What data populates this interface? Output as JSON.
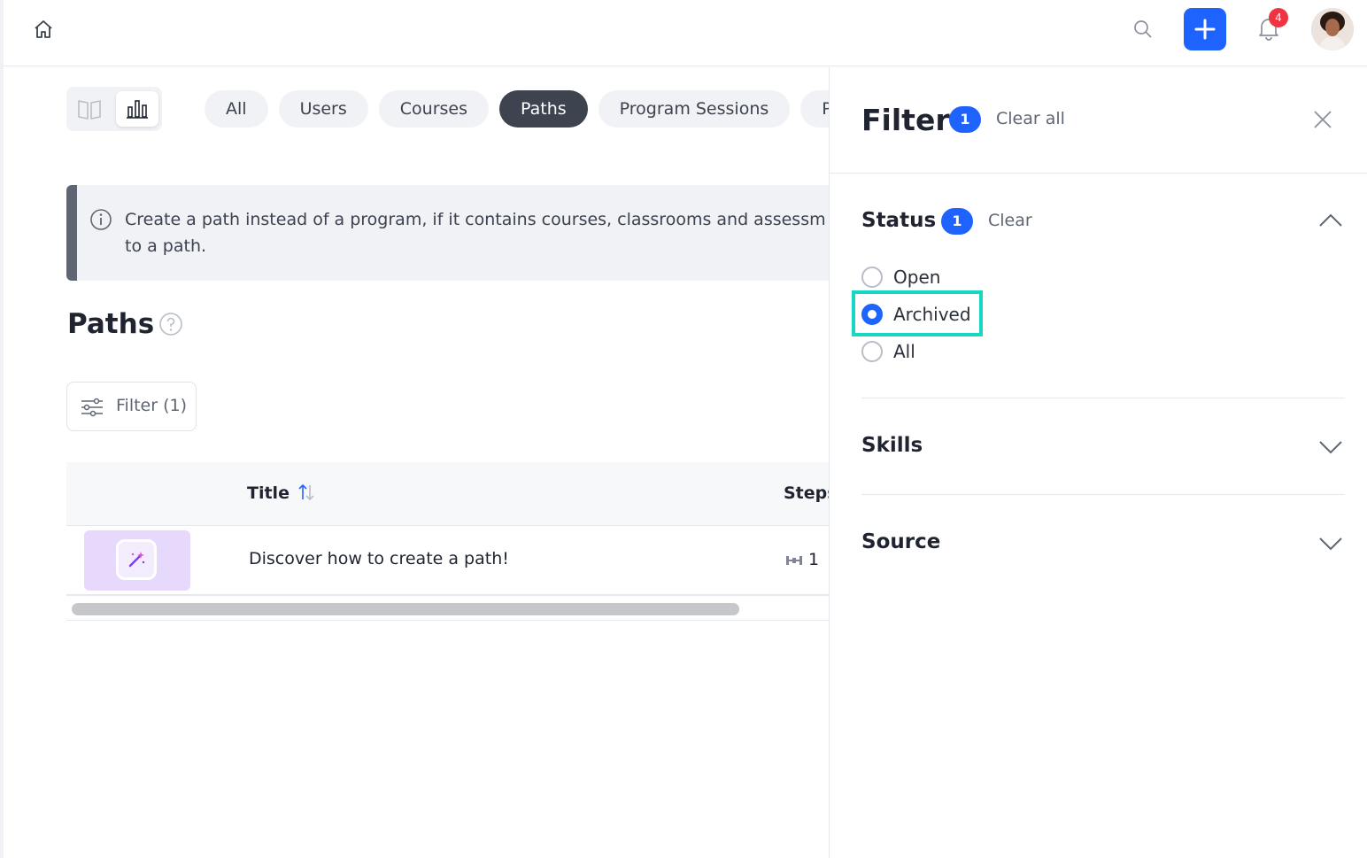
{
  "topbar": {
    "icons": [
      "home-icon",
      "search-icon",
      "plus-icon",
      "bell-icon"
    ],
    "notification_count": "4",
    "accent_color": "#1f63ff"
  },
  "view_toggle": {
    "icons": [
      "book-icon",
      "bar-chart-icon"
    ],
    "selected": "bar-chart-icon"
  },
  "tabs": [
    {
      "label": "All",
      "active": false
    },
    {
      "label": "Users",
      "active": false
    },
    {
      "label": "Courses",
      "active": false
    },
    {
      "label": "Paths",
      "active": true
    },
    {
      "label": "Program Sessions",
      "active": false
    },
    {
      "label": "P",
      "active": false
    }
  ],
  "info_banner": {
    "line1": "Create a path instead of a program, if it contains courses, classrooms and assessm",
    "line2": "to a path."
  },
  "page": {
    "title": "Paths"
  },
  "filter_button": {
    "label": "Filter (1)"
  },
  "table": {
    "columns": [
      "Title",
      "Steps"
    ],
    "rows": [
      {
        "title": "Discover how to create a path!",
        "steps": "1"
      }
    ]
  },
  "filter_panel": {
    "title": "Filter",
    "count": "1",
    "clear_all": "Clear all",
    "status": {
      "title": "Status",
      "count": "1",
      "clear": "Clear",
      "options": [
        "Open",
        "Archived",
        "All"
      ],
      "selected": "Archived",
      "highlight_color": "#17d6c4"
    },
    "skills": {
      "title": "Skills"
    },
    "source": {
      "title": "Source"
    }
  }
}
